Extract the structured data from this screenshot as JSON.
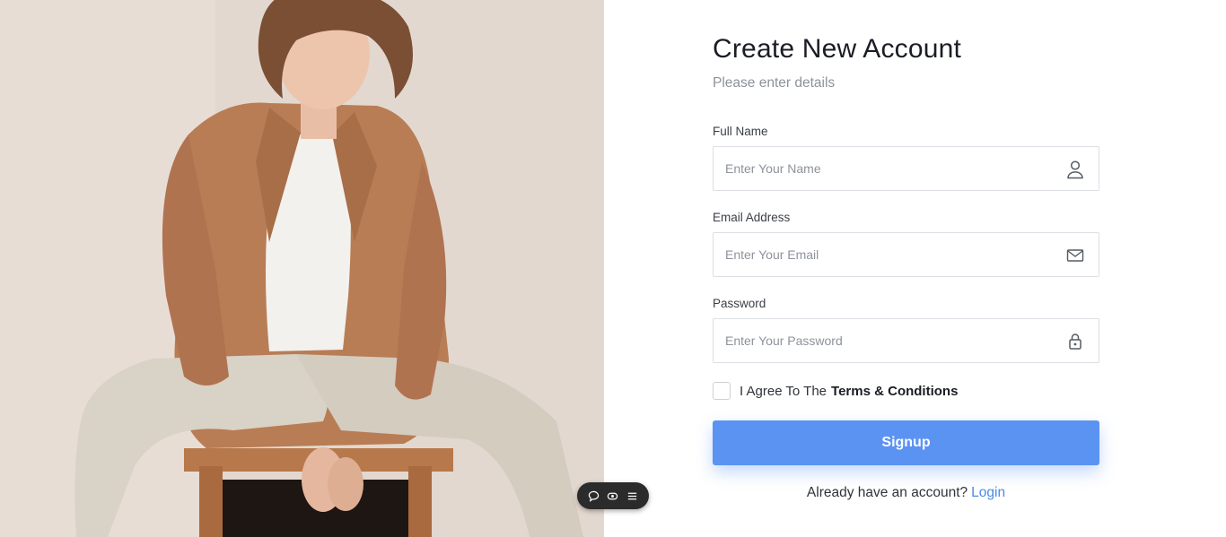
{
  "hero": {
    "image": "man-in-tan-blazer-sitting-on-stool"
  },
  "form": {
    "title": "Create New Account",
    "subtitle": "Please enter details",
    "fields": [
      {
        "label": "Full Name",
        "placeholder": "Enter Your Name",
        "icon": "user-icon"
      },
      {
        "label": "Email Address",
        "placeholder": "Enter Your Email",
        "icon": "mail-icon"
      },
      {
        "label": "Password",
        "placeholder": "Enter Your Password",
        "icon": "lock-icon"
      }
    ],
    "agree_prefix": "I Agree To The",
    "agree_link": "Terms & Conditions",
    "submit_label": "Signup",
    "footer_text": "Already have an account?",
    "footer_link": "Login"
  },
  "toolbar": {
    "icons": [
      "chat-bubble-icon",
      "eye-icon",
      "menu-icon"
    ]
  },
  "colors": {
    "accent": "#5b93f2",
    "link": "#4a8ae8",
    "title": "#1a1d24",
    "muted": "#8d929a",
    "border": "#dcdfe4"
  }
}
